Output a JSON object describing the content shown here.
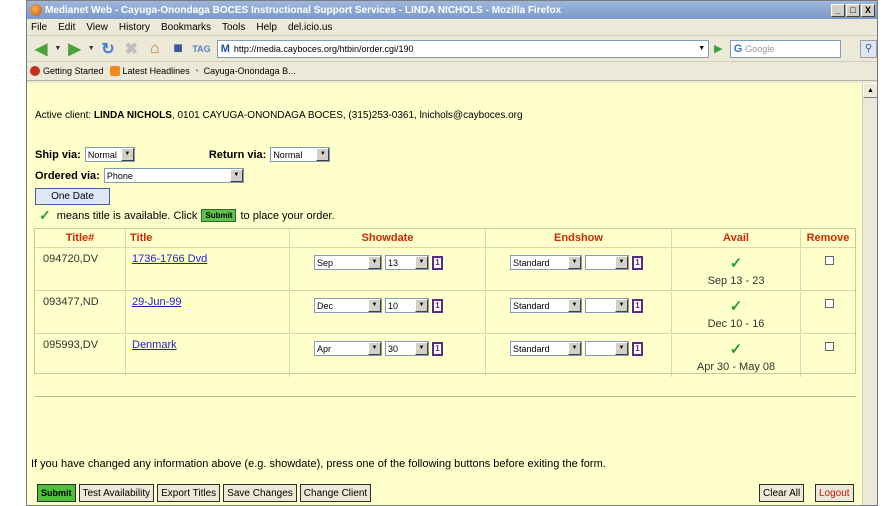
{
  "window": {
    "title": "Medianet Web - Cayuga-Onondaga BOCES Instructional Support Services - LINDA NICHOLS - Mozilla Firefox",
    "controls": [
      "_",
      "□",
      "X"
    ]
  },
  "menu": [
    "File",
    "Edit",
    "View",
    "History",
    "Bookmarks",
    "Tools",
    "Help",
    "del.icio.us"
  ],
  "nav": {
    "url": "http://media.cayboces.org/htbin/order.cgi/190",
    "search_placeholder": "Google",
    "tag_label": "TAG"
  },
  "bookmarks": [
    "Getting Started",
    "Latest Headlines",
    "Cayuga-Onondaga B..."
  ],
  "client": {
    "prefix": "Active client: ",
    "name": "LINDA NICHOLS",
    "details": ", 0101 CAYUGA-ONONDAGA BOCES, (315)253-0361, lnichols@cayboces.org"
  },
  "form": {
    "ship_via_label": "Ship via:",
    "ship_via_value": "Normal",
    "return_via_label": "Return via:",
    "return_via_value": "Normal",
    "ordered_via_label": "Ordered via:",
    "ordered_via_value": "Phone",
    "one_date_label": "One Date",
    "avail_note_pre": "means title is available. Click",
    "avail_note_submit": "Submit",
    "avail_note_post": "to place your order."
  },
  "table": {
    "headers": [
      "Title#",
      "Title",
      "Showdate",
      "Endshow",
      "Avail",
      "Remove"
    ],
    "rows": [
      {
        "num": "094720,DV",
        "title": "1736-1766 Dvd",
        "month": "Sep",
        "day": "13",
        "endshow": "Standard",
        "avail": "Sep 13 - 23"
      },
      {
        "num": "093477,ND",
        "title": "29-Jun-99",
        "month": "Dec",
        "day": "10",
        "endshow": "Standard",
        "avail": "Dec 10 - 16"
      },
      {
        "num": "095993,DV",
        "title": "Denmark",
        "month": "Apr",
        "day": "30",
        "endshow": "Standard",
        "avail": "Apr 30 - May 08"
      }
    ]
  },
  "footer": {
    "info": "If you have changed any information above (e.g. showdate), press one of the following buttons before exiting the form.",
    "buttons": [
      "Submit",
      "Test Availability",
      "Export Titles",
      "Save Changes",
      "Change Client"
    ],
    "clear_all": "Clear All",
    "logout": "Logout"
  },
  "colors": {
    "page_bg": "#ffffcc",
    "header_red": "#cc2b00",
    "link_blue": "#1f1fd0",
    "check_green": "#2aa02a"
  }
}
